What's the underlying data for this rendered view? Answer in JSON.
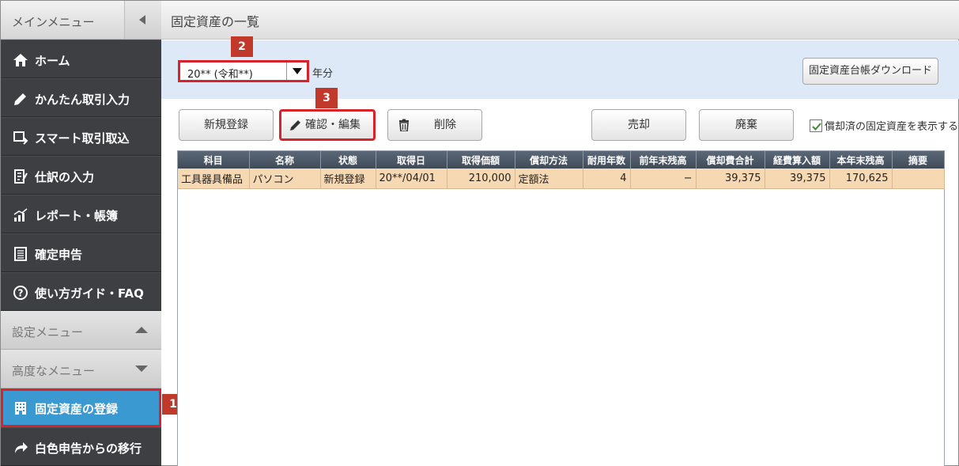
{
  "sidebar": {
    "title": "メインメニュー",
    "items": [
      {
        "label": "ホーム",
        "icon": "home-icon"
      },
      {
        "label": "かんたん取引入力",
        "icon": "pencil-icon"
      },
      {
        "label": "スマート取引取込",
        "icon": "import-icon"
      },
      {
        "label": "仕訳の入力",
        "icon": "journal-icon"
      },
      {
        "label": "レポート・帳簿",
        "icon": "report-icon"
      },
      {
        "label": "確定申告",
        "icon": "tax-return-icon"
      },
      {
        "label": "使い方ガイド・FAQ",
        "icon": "help-icon"
      }
    ],
    "settings_menu": "設定メニュー",
    "advanced_menu": "高度なメニュー",
    "fixed_asset_register": "固定資産の登録",
    "blue_migration": "白色申告からの移行"
  },
  "page": {
    "title": "固定資産の一覧"
  },
  "filter": {
    "year_value": "20** (令和**)",
    "year_unit": "年分",
    "download_button": "固定資産台帳ダウンロード"
  },
  "toolbar": {
    "new": "新規登録",
    "edit": "確認・編集",
    "delete": "削除",
    "sell": "売却",
    "dispose": "廃棄",
    "show_depreciated": "償却済の固定資産を表示する",
    "show_depreciated_checked": true
  },
  "badges": {
    "one": "1",
    "two": "2",
    "three": "3"
  },
  "table": {
    "headers": [
      "科目",
      "名称",
      "状態",
      "取得日",
      "取得価額",
      "償却方法",
      "耐用年数",
      "前年末残高",
      "償却費合計",
      "経費算入額",
      "本年末残高",
      "摘要"
    ],
    "rows": [
      [
        "工具器具備品",
        "パソコン",
        "新規登録",
        "20**/04/01",
        "210,000",
        "定額法",
        "4",
        "−",
        "39,375",
        "39,375",
        "170,625",
        ""
      ]
    ]
  },
  "colors": {
    "sidebar_bg": "#3d3f42",
    "active_item": "#3a99d0",
    "highlight_border": "#d8232a",
    "badge_bg": "#c0392b",
    "filter_bg": "#dde9f7",
    "row_bg": "#f6d9b3"
  }
}
